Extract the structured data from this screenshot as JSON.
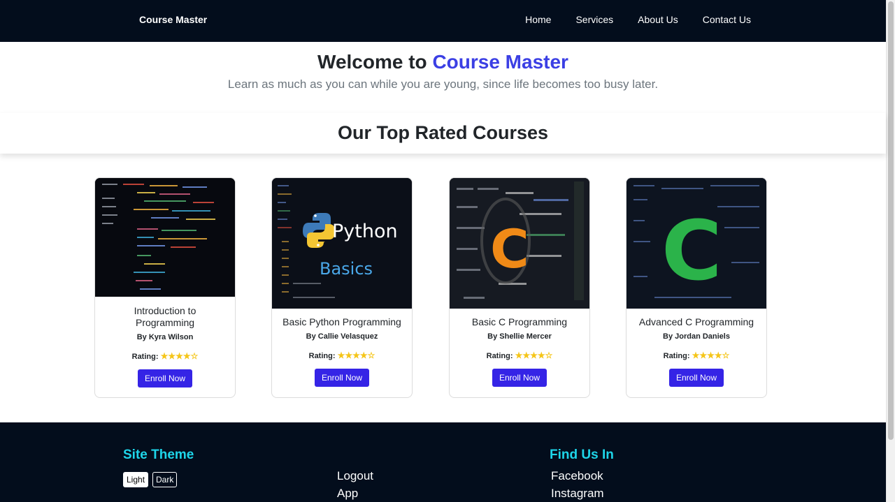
{
  "nav": {
    "brand": "Course Master",
    "links": [
      "Home",
      "Services",
      "About Us",
      "Contact Us"
    ]
  },
  "hero": {
    "title_prefix": "Welcome to",
    "title_accent": "Course Master",
    "subtitle": "Learn as much as you can while you are young, since life becomes too busy later."
  },
  "section": {
    "title": "Our Top Rated Courses"
  },
  "courses": [
    {
      "title": "Introduction to Programming",
      "author": "By Kyra Wilson",
      "rating_label": "Rating:",
      "stars": "★★★★☆",
      "rating": 4,
      "button": "Enroll Now"
    },
    {
      "title": "Basic Python Programming",
      "author": "By Callie Velasquez",
      "rating_label": "Rating:",
      "stars": "★★★★☆",
      "rating": 4,
      "button": "Enroll Now",
      "image_text": [
        "Python",
        "Basics"
      ]
    },
    {
      "title": "Basic C Programming",
      "author": "By Shellie Mercer",
      "rating_label": "Rating:",
      "stars": "★★★★☆",
      "rating": 4,
      "button": "Enroll Now",
      "image_text": "C"
    },
    {
      "title": "Advanced C Programming",
      "author": "By Jordan Daniels",
      "rating_label": "Rating:",
      "stars": "★★★★☆",
      "rating": 4,
      "button": "Enroll Now",
      "image_text": "C"
    }
  ],
  "footer": {
    "theme_heading": "Site Theme",
    "theme_light": "Light",
    "theme_dark": "Dark",
    "links_mid": [
      "Logout",
      "App"
    ],
    "find_heading": "Find Us In",
    "social": [
      "Facebook",
      "Instagram"
    ]
  },
  "colors": {
    "navbar_bg": "#030d1c",
    "accent_blue": "#3b3fe4",
    "button_bg": "#3524e6",
    "footer_heading": "#1ed5e9",
    "star": "#f5c518"
  }
}
